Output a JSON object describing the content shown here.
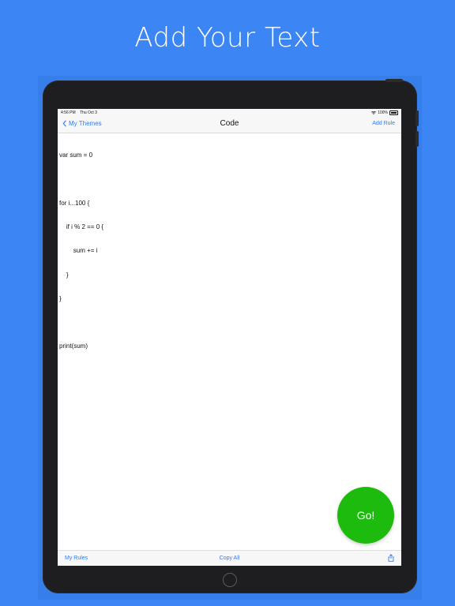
{
  "headline": "Add Your Text",
  "status": {
    "time": "4:56 PM",
    "date": "Thu Oct 3",
    "battery": "100%"
  },
  "nav": {
    "back_label": "My Themes",
    "title": "Code",
    "right_label": "Add Rule"
  },
  "editor": {
    "lines": [
      "var sum = 0",
      "",
      "for i...100 {",
      "    if i % 2 == 0 {",
      "        sum += i",
      "    }",
      "}",
      "",
      "print(sum)"
    ]
  },
  "go_button": {
    "label": "Go!",
    "color": "#1dbb0d"
  },
  "toolbar": {
    "left_label": "My Rules",
    "center_label": "Copy All",
    "share_icon": "share-icon"
  },
  "colors": {
    "background": "#3b86f4",
    "accent": "#2f7df6"
  }
}
